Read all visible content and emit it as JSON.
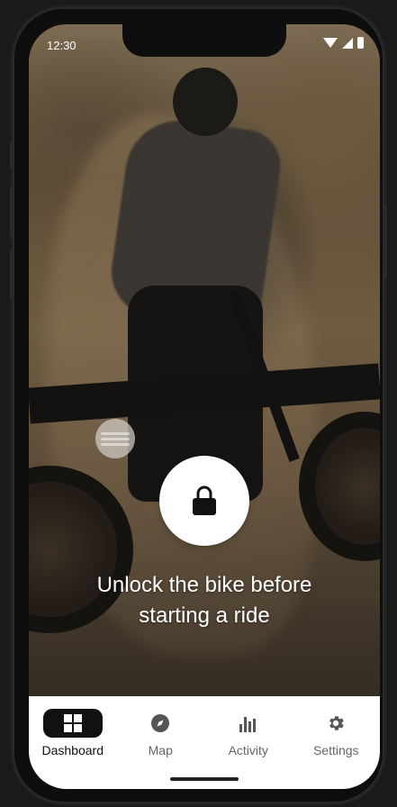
{
  "status_bar": {
    "time": "12:30"
  },
  "unlock": {
    "message_line1": "Unlock the bike before",
    "message_line2": "starting a ride",
    "lock_icon": "lock-icon",
    "slider_icon": "slide-handle"
  },
  "tabs": [
    {
      "label": "Dashboard",
      "icon": "dashboard-icon",
      "active": true
    },
    {
      "label": "Map",
      "icon": "compass-icon",
      "active": false
    },
    {
      "label": "Activity",
      "icon": "bar-chart-icon",
      "active": false
    },
    {
      "label": "Settings",
      "icon": "gear-icon",
      "active": false
    }
  ],
  "colors": {
    "tabbar_bg": "#ffffff",
    "active_tab_bg": "#111111",
    "lock_button_bg": "#ffffff"
  }
}
